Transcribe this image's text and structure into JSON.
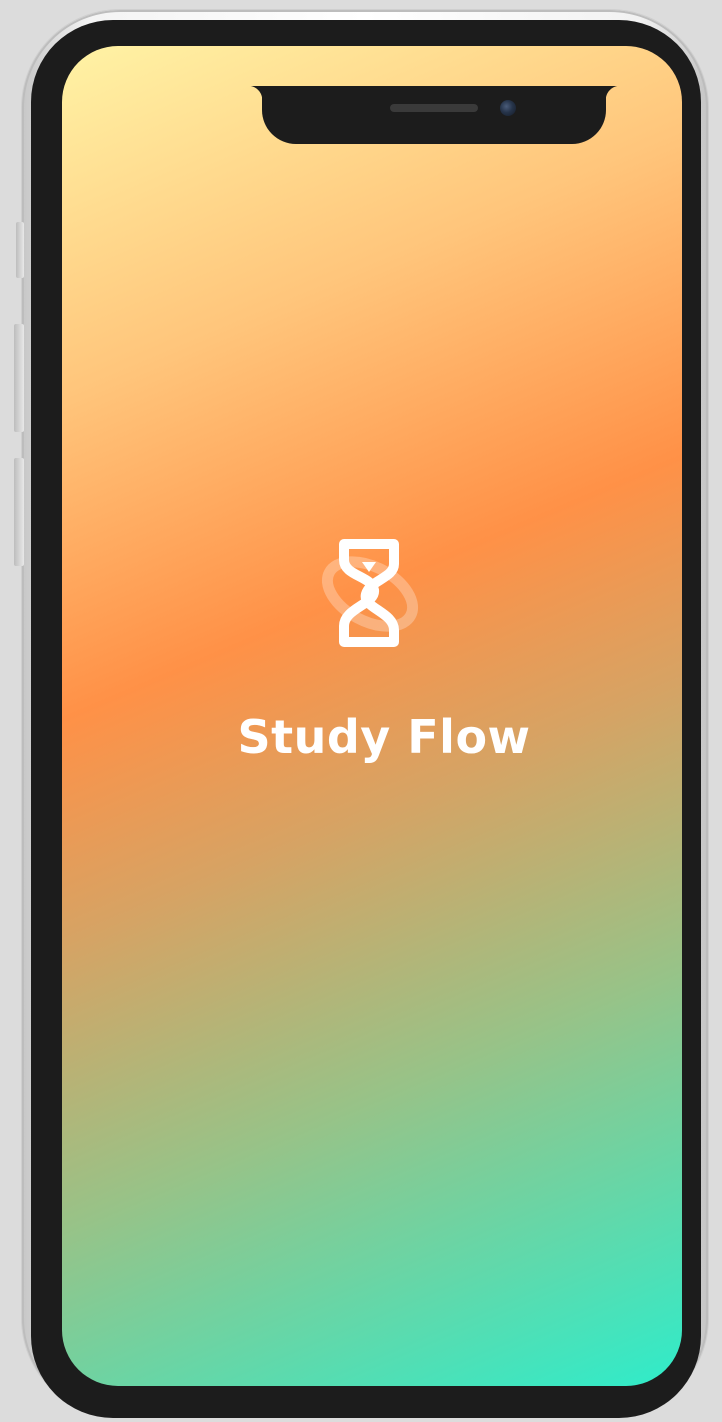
{
  "app": {
    "name": "Study Flow",
    "logo_icon": "hourglass-s-logo-icon"
  },
  "device": {
    "frame": "iphone-silver"
  },
  "colors": {
    "gradient_start": "#fff3a5",
    "gradient_mid": "#ff9147",
    "gradient_end": "#2fecca",
    "text": "#ffffff"
  }
}
